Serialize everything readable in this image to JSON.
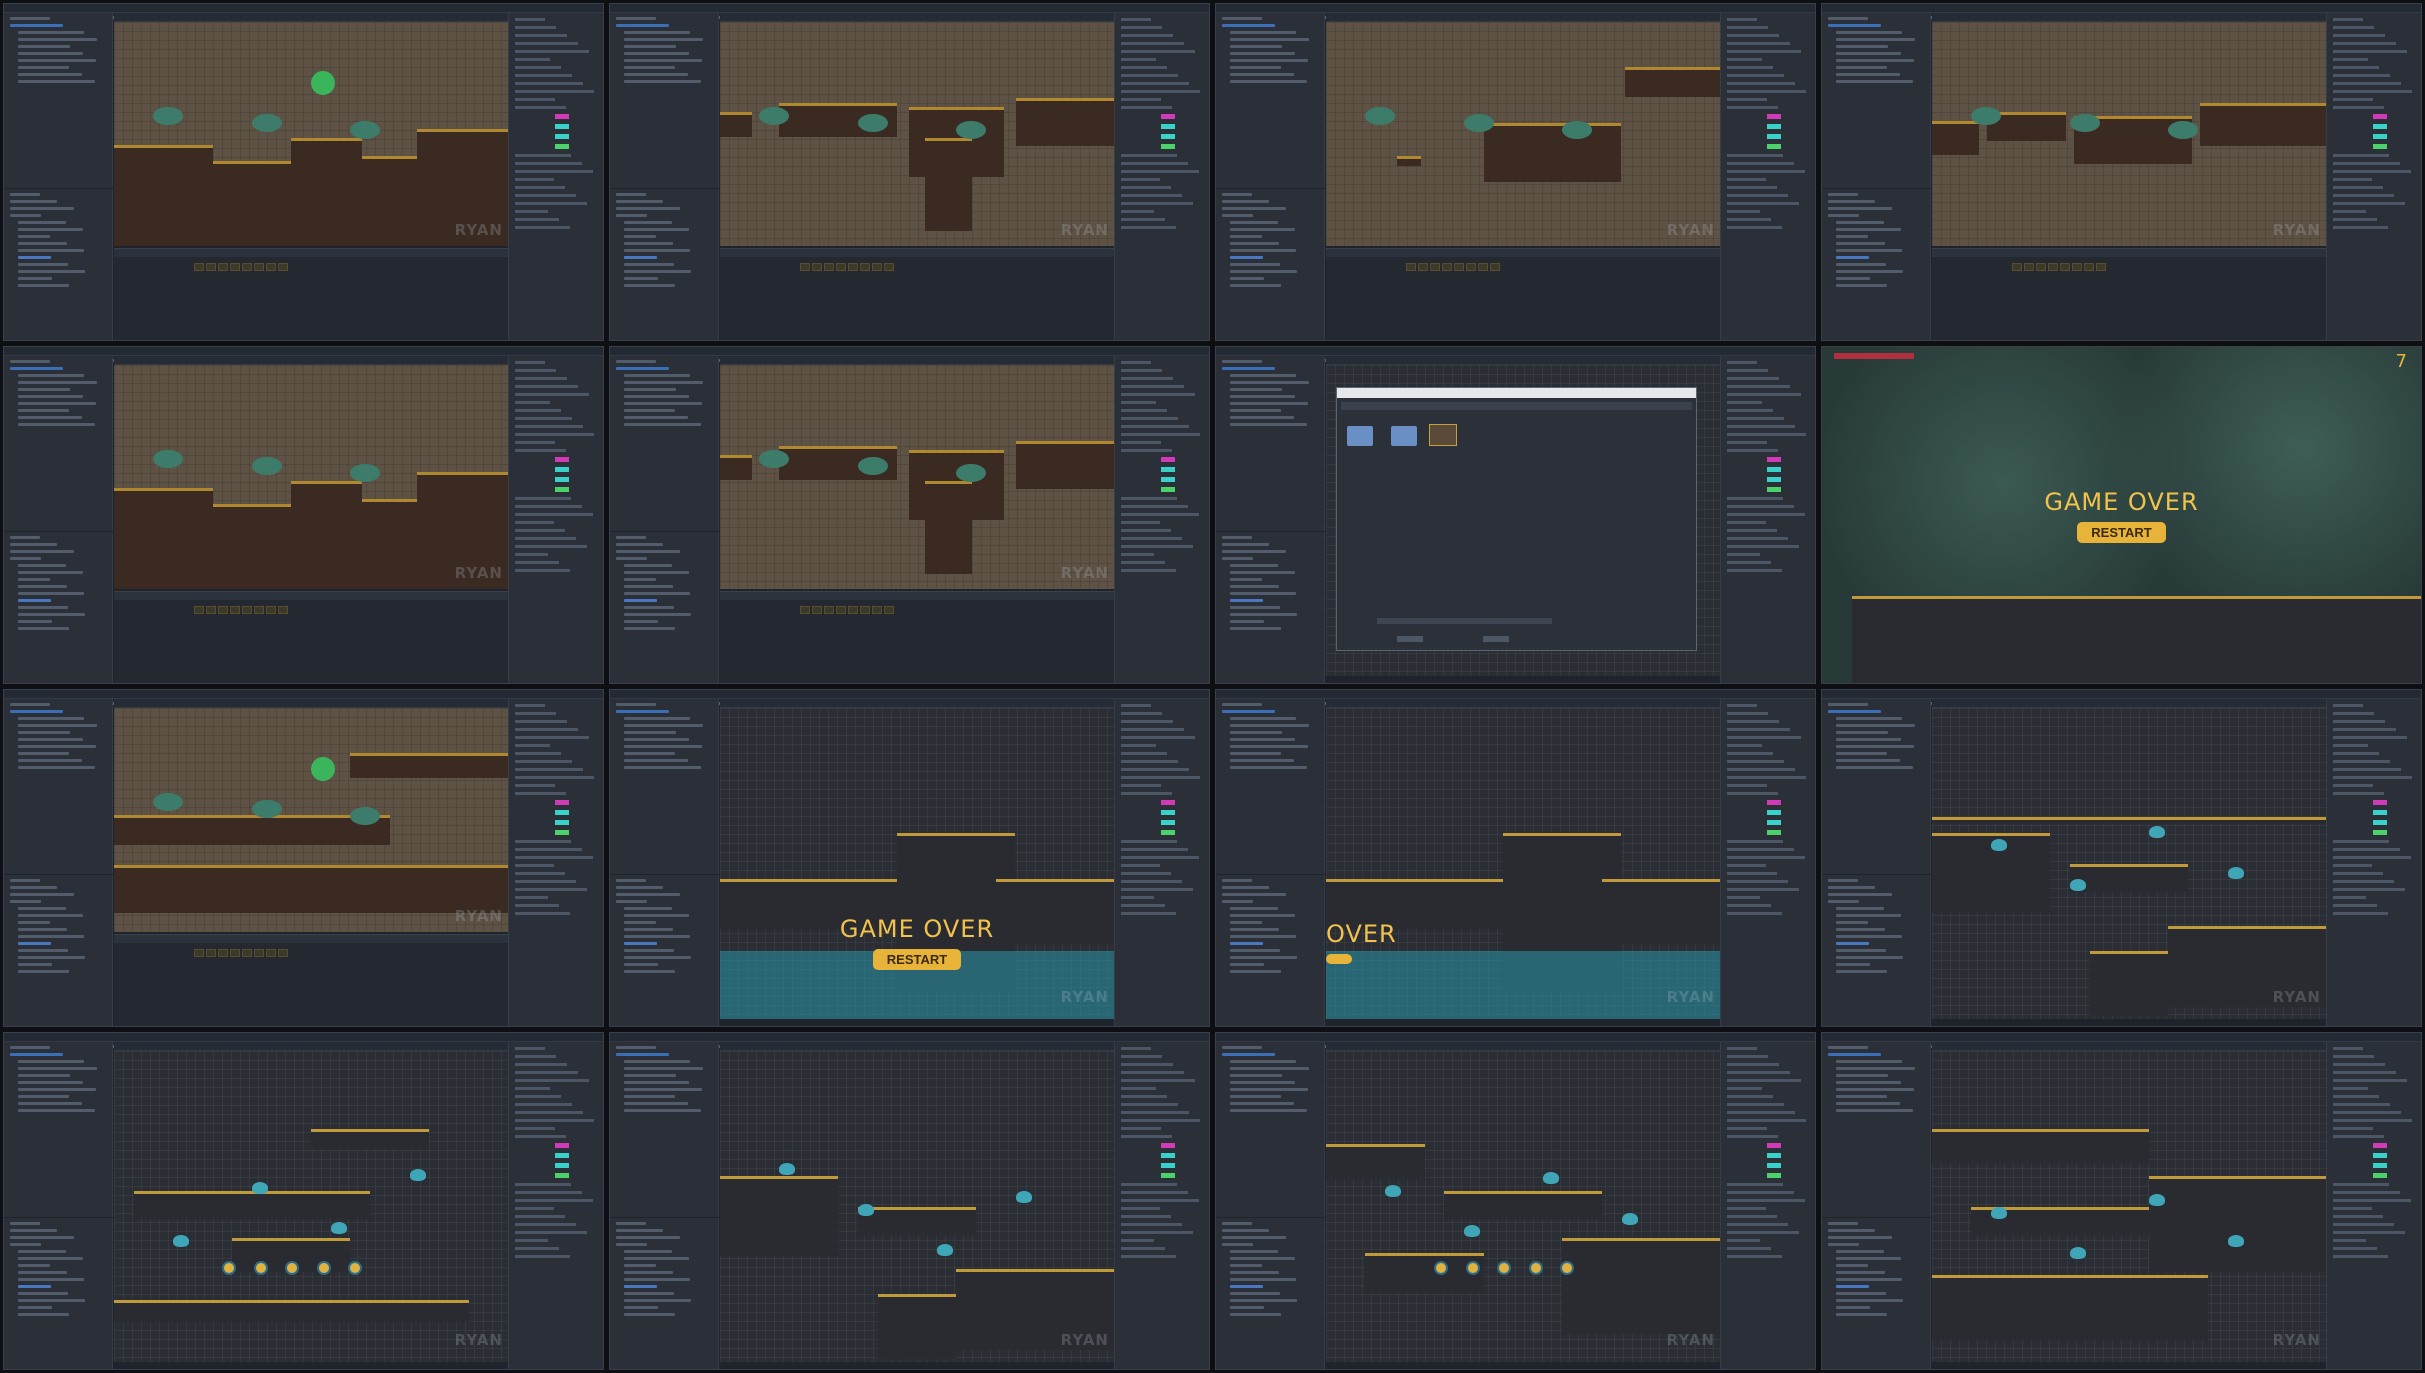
{
  "screenshots": [
    {
      "kind": "editor-tilemap",
      "variant": "a",
      "has_ball": true
    },
    {
      "kind": "editor-tilemap",
      "variant": "b"
    },
    {
      "kind": "editor-tilemap",
      "variant": "c"
    },
    {
      "kind": "editor-tilemap",
      "variant": "d"
    },
    {
      "kind": "editor-tilemap",
      "variant": "a"
    },
    {
      "kind": "editor-tilemap",
      "variant": "b"
    },
    {
      "kind": "file-dialog"
    },
    {
      "kind": "game-over-forest"
    },
    {
      "kind": "editor-tilemap",
      "variant": "water",
      "has_ball": true
    },
    {
      "kind": "game-over-blue"
    },
    {
      "kind": "game-over-partial"
    },
    {
      "kind": "editor-runtime"
    },
    {
      "kind": "editor-dark"
    },
    {
      "kind": "editor-dark"
    },
    {
      "kind": "editor-dark"
    },
    {
      "kind": "editor-dark"
    }
  ],
  "game_over": {
    "title": "GAME OVER",
    "restart": "RESTART",
    "partial_title": "OVER",
    "score": "7"
  },
  "watermark": "RYAN",
  "colors": {
    "gold": "#e8b339",
    "ball": "#3ab55c",
    "slime": "#3fa6b8",
    "health": "#b03040"
  }
}
